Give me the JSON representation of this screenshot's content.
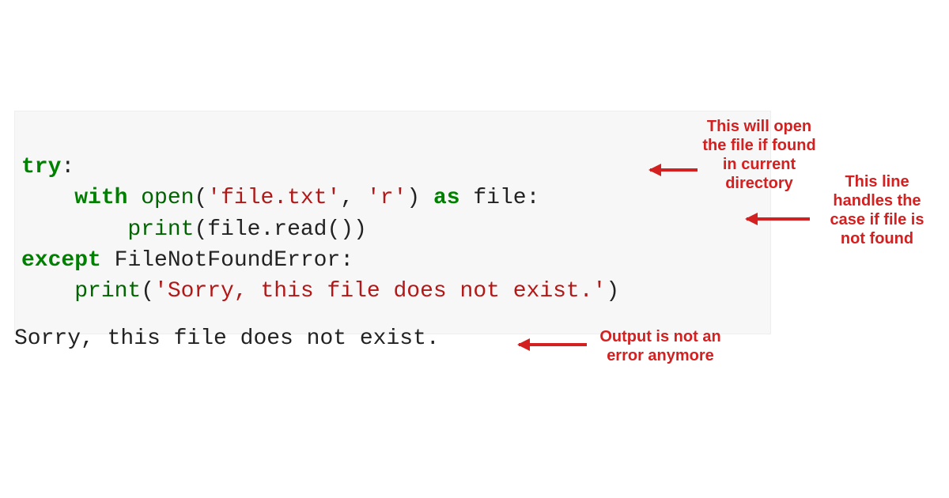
{
  "code": {
    "line1": {
      "kw": "try",
      "colon": ":"
    },
    "line2": {
      "indent": "    ",
      "kw1": "with",
      "sp1": " ",
      "fn": "open",
      "paren1": "(",
      "str1": "'file.txt'",
      "comma": ", ",
      "str2": "'r'",
      "paren2": ") ",
      "kw2": "as",
      "sp2": " ",
      "var": "file:"
    },
    "line3": {
      "indent": "        ",
      "fn": "print",
      "paren1": "(",
      "arg": "file.read()",
      "paren2": ")"
    },
    "line4": {
      "kw": "except",
      "sp": " ",
      "err": "FileNotFoundError:",
      "colon": ""
    },
    "line5": {
      "indent": "    ",
      "fn": "print",
      "paren1": "(",
      "str": "'Sorry, this file does not exist.'",
      "paren2": ")"
    }
  },
  "output": "Sorry, this file does not exist.",
  "annotations": {
    "ann1": "This will open the file if found in current directory",
    "ann2": "This line handles the case if file is not found",
    "ann3": "Output is not an error anymore"
  }
}
